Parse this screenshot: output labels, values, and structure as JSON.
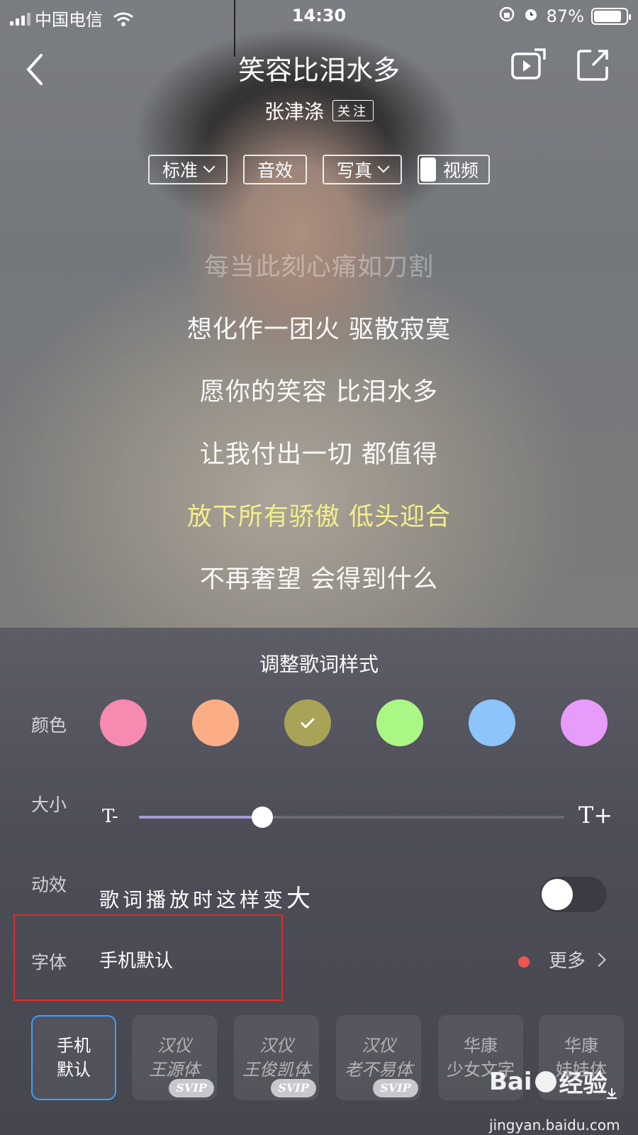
{
  "status_bar": {
    "carrier": "中国电信",
    "time": "14:30",
    "battery": "87%",
    "battery_level": 0.87
  },
  "header": {
    "title": "笑容比泪水多",
    "artist": "张津涤",
    "follow_label": "关注"
  },
  "modes": {
    "standard": "标准",
    "effects": "音效",
    "photo": "写真",
    "video": "视频"
  },
  "lyrics": [
    {
      "text": "每当此刻心痛如刀割",
      "state": "faded"
    },
    {
      "text": "想化作一团火 驱散寂寞",
      "state": "normal"
    },
    {
      "text": "愿你的笑容 比泪水多",
      "state": "normal"
    },
    {
      "text": "让我付出一切 都值得",
      "state": "normal"
    },
    {
      "text": "放下所有骄傲 低头迎合",
      "state": "active"
    },
    {
      "text": "不再奢望 会得到什么",
      "state": "normal"
    }
  ],
  "panel": {
    "title": "调整歌词样式",
    "color_label": "颜色",
    "colors": [
      "#f68ab0",
      "#fbae86",
      "#a8a356",
      "#abf786",
      "#8cc4fb",
      "#e79bfa"
    ],
    "selected_color_index": 2,
    "size_label": "大小",
    "size_minus": "T-",
    "size_plus": "T+",
    "size_value": 0.29,
    "animation_label": "动效",
    "animation_text": "歌词播放时这样变",
    "animation_text_big": "大",
    "animation_enabled": false,
    "font_label": "字体",
    "font_value": "手机默认",
    "more_label": "更多",
    "fonts": [
      {
        "line1": "手机",
        "line2": "默认",
        "badge": "",
        "selected": true
      },
      {
        "line1": "汉仪",
        "line2": "王源体",
        "badge": "SVIP",
        "selected": false
      },
      {
        "line1": "汉仪",
        "line2": "王俊凯体",
        "badge": "SVIP",
        "selected": false
      },
      {
        "line1": "汉仪",
        "line2": "老不易体",
        "badge": "SVIP",
        "selected": false
      },
      {
        "line1": "华康",
        "line2": "少女文字",
        "badge": "",
        "selected": false
      },
      {
        "line1": "华康",
        "line2": "娃娃体",
        "badge": "",
        "selected": false
      }
    ]
  },
  "watermark": {
    "logo_left": "Bai",
    "logo_right": "经验",
    "url": "jingyan.baidu.com"
  }
}
